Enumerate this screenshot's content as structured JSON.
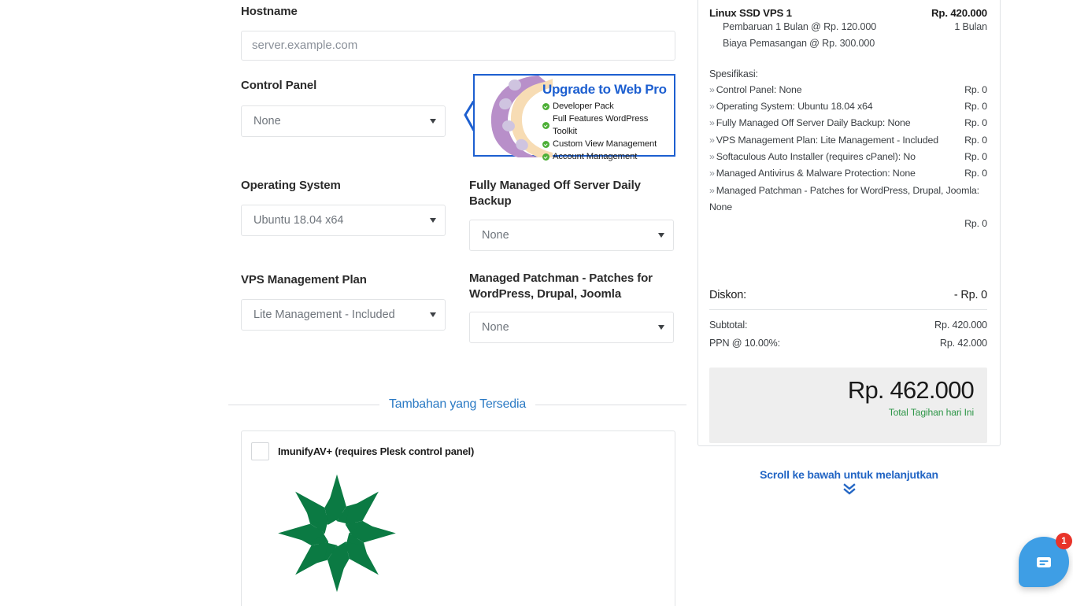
{
  "form": {
    "hostname": {
      "label": "Hostname",
      "placeholder": "server.example.com",
      "value": ""
    },
    "control_panel": {
      "label": "Control Panel",
      "value": "None"
    },
    "operating_system": {
      "label": "Operating System",
      "value": "Ubuntu 18.04 x64"
    },
    "backup": {
      "label": "Fully Managed Off Server Daily Backup",
      "value": "None"
    },
    "vps_plan": {
      "label": "VPS Management Plan",
      "value": "Lite Management - Included"
    },
    "patchman": {
      "label": "Managed Patchman - Patches for WordPress, Drupal, Joomla",
      "value": "None"
    }
  },
  "promo": {
    "title": "Upgrade to Web Pro",
    "features": [
      "Developer Pack",
      "Full Features WordPress Toolkit",
      "Custom View Management",
      "Account Management"
    ],
    "border_color": "#1d5fd0",
    "title_color": "#1d5fd0",
    "check_color": "#4caf36"
  },
  "addons_section": {
    "divider_title": "Tambahan yang Tersedia",
    "divider_color": "#2b7ac4",
    "items": [
      {
        "label": "ImunifyAV+ (requires Plesk control panel)",
        "checked": false,
        "logo": "imunify-pinwheel-logo",
        "logo_color": "#0b7a43"
      }
    ]
  },
  "summary": {
    "product_name": "Linux SSD VPS 1",
    "product_price": "Rp. 420.000",
    "sub_lines": [
      {
        "text": "Pembaruan 1 Bulan @ Rp. 120.000",
        "right": "1 Bulan"
      },
      {
        "text": "Biaya Pemasangan @ Rp. 300.000",
        "right": ""
      }
    ],
    "spec_title": "Spesifikasi:",
    "specs": [
      {
        "label": "Control Panel: None",
        "price": "Rp. 0",
        "wrap": false
      },
      {
        "label": "Operating System: Ubuntu 18.04 x64",
        "price": "Rp. 0",
        "wrap": false
      },
      {
        "label": "Fully Managed Off Server Daily Backup: None",
        "price": "Rp. 0",
        "wrap": false
      },
      {
        "label": "VPS Management Plan: Lite Management - Included",
        "price": "Rp. 0",
        "wrap": false
      },
      {
        "label": "Softaculous Auto Installer (requires cPanel): No",
        "price": "Rp. 0",
        "wrap": false
      },
      {
        "label": "Managed Antivirus & Malware Protection: None",
        "price": "Rp. 0",
        "wrap": false
      },
      {
        "label": "Managed Patchman - Patches for WordPress, Drupal, Joomla: None",
        "price": "Rp. 0",
        "wrap": true
      }
    ],
    "discount_label": "Diskon:",
    "discount_value": "- Rp. 0",
    "subtotal_label": "Subtotal:",
    "subtotal_value": "Rp. 420.000",
    "tax_label": "PPN @ 10.00%:",
    "tax_value": "Rp. 42.000",
    "grand_total": "Rp. 462.000",
    "grand_caption": "Total Tagihan hari Ini",
    "grand_caption_color": "#2e9648"
  },
  "scroll_hint": {
    "text": "Scroll ke bawah untuk melanjutkan",
    "icon": "double-chevron-down-icon",
    "color": "#2265c4"
  },
  "chat": {
    "icon": "chat-message-icon",
    "badge_count": "1",
    "bubble_color": "#3e9ee5",
    "badge_color": "#e8342a"
  }
}
